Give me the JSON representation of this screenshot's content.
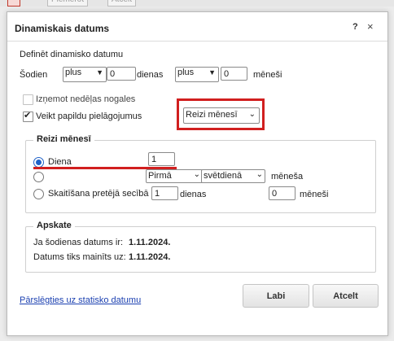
{
  "background_toolbar": {
    "btn1": "Piemērot",
    "btn2": "Atcelt"
  },
  "dialog": {
    "title": "Dinamiskais datums",
    "help": "?",
    "close": "×",
    "define_label": "Definēt dinamisko datumu",
    "today_label": "Šodien",
    "days_sign": "plus",
    "days_value": "0",
    "days_label": "dienas",
    "months_sign": "plus",
    "months_value": "0",
    "months_label": "mēneši",
    "exclude_weekends_label": "Izņemot nedēļas nogales",
    "exclude_weekends_checked": false,
    "extra_adjust_label": "Veikt papildu pielāgojumus",
    "extra_adjust_checked": true,
    "frequency_value": "Reizi mēnesī",
    "monthly_group": {
      "legend": "Reizi mēnesī",
      "day_label": "Diena",
      "day_value": "1",
      "ordinal_value": "Pirmā",
      "weekday_value": "svētdienā",
      "monthwise_label": "mēneša",
      "reverse_label": "Skaitīšana pretējā secībā",
      "reverse_days_value": "1",
      "reverse_days_label": "dienas",
      "reverse_months_value": "0",
      "reverse_months_label": "mēneši"
    },
    "summary_group": {
      "legend": "Apskate",
      "today_label": "Ja šodienas datums ir:",
      "today_value": "1.11.2024.",
      "changed_label": "Datums tiks mainīts uz:",
      "changed_value": "1.11.2024."
    },
    "switch_link": "Pārslēgties uz statisko datumu",
    "ok_label": "Labi",
    "cancel_label": "Atcelt"
  },
  "colors": {
    "highlight": "#d11f1f",
    "radio_accent": "#2062c8",
    "link": "#1a3fb0"
  }
}
